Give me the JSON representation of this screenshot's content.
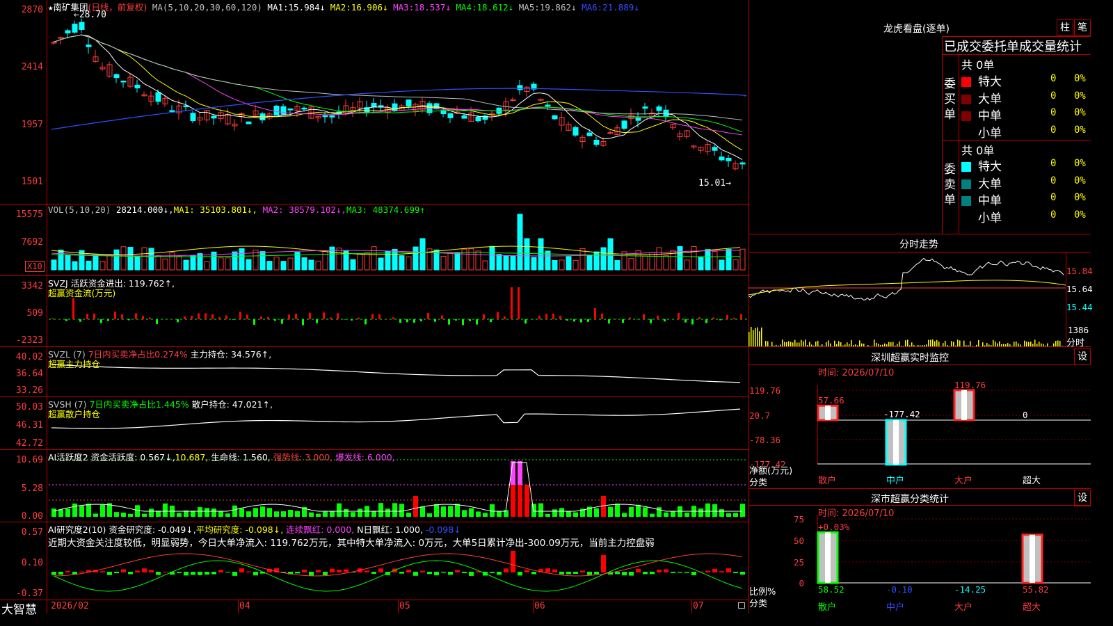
{
  "stock": {
    "star": "★",
    "name": "南矿集团",
    "mode": "(日线，前复权)",
    "ma_label": "MA(5,10,20,30,60,120)",
    "ma": [
      {
        "name": "MA1:",
        "val": "15.984↓"
      },
      {
        "name": "MA2:",
        "val": "16.906↓"
      },
      {
        "name": "MA3:",
        "val": "18.537↓"
      },
      {
        "name": "MA4:",
        "val": "18.612↓"
      },
      {
        "name": "MA5:",
        "val": "19.862↓"
      },
      {
        "name": "MA6:",
        "val": "21.889↓"
      }
    ],
    "high_mark": "←28.70",
    "low_mark": "15.01→"
  },
  "price_axis": [
    "2870",
    "2414",
    "1957",
    "1501"
  ],
  "vol": {
    "title": "VOL(5,10,20)",
    "val": "28214.000↓,",
    "ma1": "MA1: 35103.801↓,",
    "ma2": "MA2: 38579.102↓,",
    "ma3": "MA3: 48374.699↑",
    "axis": [
      "15575",
      "7692"
    ],
    "unit": "X10"
  },
  "svzj": {
    "title": "SVZJ  活跃资金进出: 119.762↑,",
    "sub": "超赢资金流(万元)",
    "axis": [
      "3342",
      "509",
      "-2323"
    ]
  },
  "svzl": {
    "title": "SVZL (7)",
    "pct": "7日内买卖净占比0.274%",
    "hold": "主力持仓: 34.576↑,",
    "sub": "超赢主力持仓",
    "axis": [
      "40.02",
      "36.64",
      "33.26"
    ]
  },
  "svsh": {
    "title": "SVSH (7)",
    "pct": "7日内买卖净占比1.445%",
    "hold": "散户持仓: 47.021↑,",
    "sub": "超赢散户持仓",
    "axis": [
      "50.03",
      "46.31",
      "42.72"
    ]
  },
  "ai1": {
    "title": "AI活跃度2 资金活跃度: 0.567↓,",
    "v2": "10.687,",
    "life": "生命线: 1.560,",
    "strong": "强势线: 3.000,",
    "burst": "爆发线: 6.000,",
    "axis": [
      "10.69",
      "5.28",
      "0.00"
    ]
  },
  "ai2": {
    "title": "AI研究度2(10) 资金研究度: -0.049↓,",
    "avg": "平均研究度: -0.098↓,",
    "lianxu": "连续飘红: 0.000,",
    "nri": "N日飘红: 1.000,",
    "v": "-0.098↓",
    "comment": "近期大资金关注度较低，明显弱势，今日大单净流入: 119.762万元，其中特大单净流入: 0万元，大单5日累计净出-300.09万元，当前主力控盘弱",
    "axis": [
      "0.57",
      "0.10",
      "-0.37"
    ]
  },
  "xaxis": [
    "2026/02",
    "04",
    "05",
    "06",
    "07"
  ],
  "brand": "大智慧",
  "lhb": {
    "title": "龙虎看盘(逐单)",
    "btn1": "柱",
    "btn2": "笔",
    "header": "已成交委托单成交量统计",
    "buy_label": "委买单",
    "sell_label": "委卖单",
    "buy_total": "共 0单",
    "sell_total": "共 0单",
    "buy": [
      {
        "name": "特大",
        "n": "0",
        "p": "0%",
        "color": "#ff0000"
      },
      {
        "name": "大单",
        "n": "0",
        "p": "0%",
        "color": "#800000"
      },
      {
        "name": "中单",
        "n": "0",
        "p": "0%",
        "color": "#800000"
      },
      {
        "name": "小单",
        "n": "0",
        "p": "0%",
        "color": "#000000"
      }
    ],
    "sell": [
      {
        "name": "特大",
        "n": "0",
        "p": "0%",
        "color": "#00ffff"
      },
      {
        "name": "大单",
        "n": "0",
        "p": "0%",
        "color": "#008080"
      },
      {
        "name": "中单",
        "n": "0",
        "p": "0%",
        "color": "#008080"
      },
      {
        "name": "小单",
        "n": "0",
        "p": "0%",
        "color": "#000000"
      }
    ]
  },
  "fenshi": {
    "title": "分时走势",
    "axis": [
      "15.84",
      "15.64",
      "15.44"
    ],
    "vol_label": "1386",
    "time_label": "分时"
  },
  "monitor": {
    "title": "深圳超赢实时监控",
    "btn": "设",
    "date": "时间: 2026/07/10",
    "axis": [
      "119.76",
      "20.7",
      "-78.36",
      "-177.42"
    ],
    "unit": "净额(万元)",
    "cat_label": "分类",
    "cats": [
      "散户",
      "中户",
      "大户",
      "超大"
    ],
    "vals": [
      {
        "label": "57.66",
        "value": 57.66
      },
      {
        "label": "-177.42",
        "value": -177.42
      },
      {
        "label": "119.76",
        "value": 119.76
      },
      {
        "label": "0",
        "value": 0
      }
    ]
  },
  "classify": {
    "title": "深市超赢分类统计",
    "btn": "设",
    "date": "时间: 2026/07/10",
    "axis": [
      "75",
      "50",
      "25",
      "0"
    ],
    "top_label": "+0.03%",
    "unit": "比例%",
    "cat_label": "分类",
    "cats": [
      "散户",
      "中户",
      "大户",
      "超大"
    ],
    "vals": [
      {
        "label": "58.52",
        "value": 58.52
      },
      {
        "label": "-0.10",
        "value": -0.1
      },
      {
        "label": "-14.25",
        "value": -14.25
      },
      {
        "label": "55.82",
        "value": 55.82
      }
    ]
  },
  "colors": {
    "grid": "#c00000",
    "up": "#ff3c3c",
    "down": "#00ffff",
    "ma1": "#ffffff",
    "ma2": "#ffff00",
    "ma3": "#ff40ff",
    "ma4": "#00ff00",
    "ma5": "#c0c0c0",
    "ma6": "#3050ff"
  }
}
